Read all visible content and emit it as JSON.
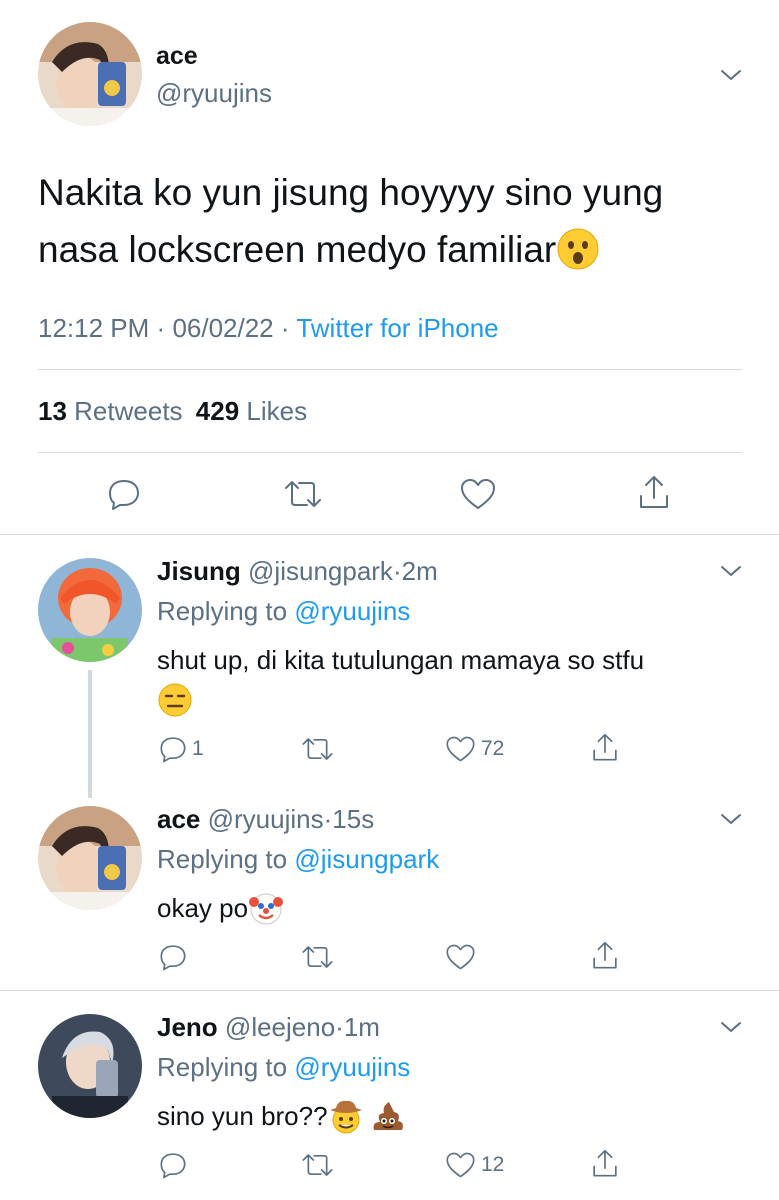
{
  "main_tweet": {
    "author_name": "ace",
    "handle": "@ryuujins",
    "text": "Nakita ko yun jisung hoyyyy sino yung nasa lockscreen medyo familiar",
    "line1": "Nakita ko yun jisung hoyyyy sino yung",
    "line2": "nasa lockscreen medyo familiar",
    "text_emoji": "astonished-face",
    "time": "12:12 PM",
    "date": "06/02/22",
    "separator": "·",
    "source": "Twitter for iPhone",
    "retweets_count": "13",
    "retweets_label": "Retweets",
    "likes_count": "429",
    "likes_label": "Likes"
  },
  "replies": [
    {
      "author_name": "Jisung",
      "handle": "@jisungpark",
      "dot": "·",
      "time": "2m",
      "replying_label": "Replying to",
      "replying_to": "@ryuujins",
      "text_line1": "shut up, di kita tutulungan mamaya so stfu",
      "text_emoji": "expressionless-face",
      "reply_count": "1",
      "retweet_count": "",
      "like_count": "72"
    },
    {
      "author_name": "ace",
      "handle": "@ryuujins",
      "dot": "·",
      "time": "15s",
      "replying_label": "Replying to",
      "replying_to": "@jisungpark",
      "text": "okay po",
      "text_emoji": "clown-face",
      "reply_count": "",
      "retweet_count": "",
      "like_count": ""
    },
    {
      "author_name": "Jeno",
      "handle": "@leejeno",
      "dot": "·",
      "time": "1m",
      "replying_label": "Replying to",
      "replying_to": "@ryuujins",
      "text": "sino yun bro??",
      "text_emojis": [
        "cowboy-face",
        "pile-of-poo"
      ],
      "reply_count": "",
      "retweet_count": "",
      "like_count": "12"
    }
  ],
  "colors": {
    "link": "#1d9bf0",
    "muted": "#5b7083",
    "divider": "#d9d9d9",
    "thread_line": "#cfd9de"
  },
  "icons": [
    "chevron-down-icon",
    "reply-icon",
    "retweet-icon",
    "like-icon",
    "share-icon"
  ]
}
